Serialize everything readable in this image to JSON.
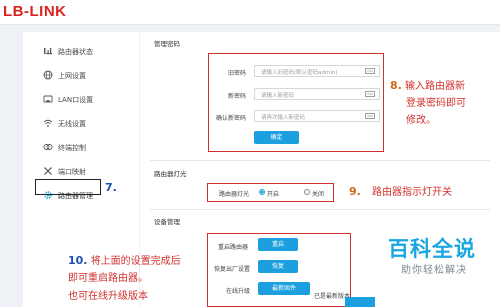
{
  "app": {
    "logo_text": "LB-LINK"
  },
  "sidebar": {
    "items": [
      {
        "label": "路由器状态",
        "icon": "network-status-icon"
      },
      {
        "label": "上网设置",
        "icon": "globe-icon"
      },
      {
        "label": "LAN口设置",
        "icon": "lan-port-icon"
      },
      {
        "label": "无线设置",
        "icon": "wifi-icon"
      },
      {
        "label": "终端控制",
        "icon": "device-control-icon"
      },
      {
        "label": "端口映射",
        "icon": "tools-icon"
      },
      {
        "label": "路由器管理",
        "icon": "gear-icon"
      }
    ]
  },
  "password_section": {
    "title": "管理密码",
    "old_label": "旧密码",
    "old_placeholder": "请输入旧密码(默认密码admin)",
    "new_label": "新密码",
    "new_placeholder": "请输入新密码",
    "confirm_label": "确认新密码",
    "confirm_placeholder": "请再次输入新密码",
    "confirm_button": "确定"
  },
  "led_section": {
    "title": "路由器灯光",
    "label": "路由器灯光",
    "option_on": "开启",
    "option_off": "关闭",
    "selected": "开启"
  },
  "device_section": {
    "title": "设备管理",
    "reboot_label": "重启路由器",
    "reboot_button": "重启",
    "reset_label": "恢复出厂设置",
    "reset_button": "恢复",
    "upgrade_label": "在线升级",
    "upgrade_button": "最新固件",
    "upgrade_status": "已是最新版本"
  },
  "annotations": {
    "step7": "7.",
    "step8_num": "8.",
    "step8_text": "输入路由器新",
    "step8_line2": "登录密码即可",
    "step8_line3": "修改。",
    "step9_num": "9.",
    "step9_text": "路由器指示灯开关",
    "step10_num": "10.",
    "step10_text": "将上面的设置完成后",
    "step10_line2": "即可重启路由器。",
    "step10_line3": "也可在线升级版本"
  },
  "watermark": {
    "title": "百科全说",
    "subtitle": "助你轻松解决"
  },
  "colors": {
    "accent_blue": "#1b9fde",
    "annotation_red": "#d0312d",
    "logo_red": "#d8231f"
  }
}
